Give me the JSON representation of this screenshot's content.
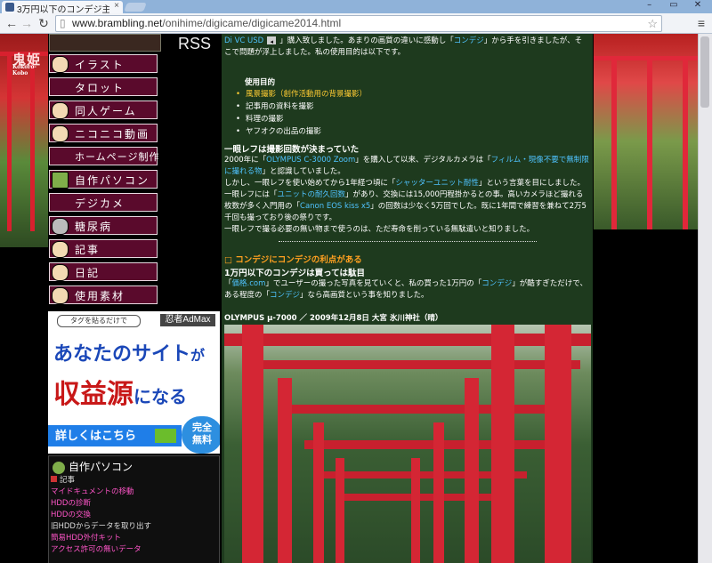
{
  "browser": {
    "tab_title": "3万円以下のコンデジ主…",
    "tab_close": "×",
    "url_host": "www.brambling.net",
    "url_path": "/onihime/digicame/digicame2014.html",
    "win_controls": [
      "–",
      "▭",
      "✕"
    ]
  },
  "site": {
    "logo_text": "鬼姫",
    "logo_small": "Kokoro-Kobo",
    "rss_label": "RSS"
  },
  "menu": {
    "items": [
      {
        "label": "イラスト",
        "name": "illust"
      },
      {
        "label": "タロット",
        "name": "tarot"
      },
      {
        "label": "同人ゲーム",
        "name": "doujin-game"
      },
      {
        "label": "ニコニコ動画",
        "name": "niconico"
      },
      {
        "label": "ホームページ制作",
        "name": "homepage"
      },
      {
        "label": "自作パソコン",
        "name": "jisaku-pc"
      },
      {
        "label": "デジカメ",
        "name": "digicame"
      },
      {
        "label": "糖尿病",
        "name": "diabetes"
      },
      {
        "label": "記事",
        "name": "articles"
      },
      {
        "label": "日記",
        "name": "diary"
      },
      {
        "label": "使用素材",
        "name": "materials"
      }
    ]
  },
  "ad": {
    "pill": "タグを貼るだけで",
    "brand": "忍者AdMax",
    "line1": "あなたのサイト",
    "line1_suffix": "が",
    "line2": "収益源",
    "line2_suffix": "になる",
    "cta": "詳しくはこちら",
    "free": "完全\n無料"
  },
  "side_section": {
    "title": "自作パソコン",
    "items": [
      {
        "text": "記事",
        "type": "plain-icon"
      },
      {
        "text": "マイドキュメントの移動",
        "type": "link"
      },
      {
        "text": "HDDの診断",
        "type": "link"
      },
      {
        "text": "HDDの交換",
        "type": "link"
      },
      {
        "text": "旧HDDからデータを取り出す",
        "type": "plain"
      },
      {
        "text": "簡易HDD外付キット",
        "type": "link"
      },
      {
        "text": "アクセス許可の無いデータ",
        "type": "link"
      }
    ]
  },
  "article": {
    "intro": {
      "link1": "Di VC USD",
      "text": "」購入致しました。あまりの画質の違いに感動し「",
      "link2": "コンデジ",
      "text2": "」から手を引きましたが、そこで問題が浮上しました。私の使用目的は以下です。"
    },
    "purpose_title": "使用目的",
    "purpose": [
      {
        "text": "風景撮影（創作活動用の背景撮影）",
        "hl": true
      },
      {
        "text": "記事用の資料を撮影",
        "hl": false
      },
      {
        "text": "料理の撮影",
        "hl": false
      },
      {
        "text": "ヤフオクの出品の撮影",
        "hl": false
      }
    ],
    "h1": "一眼レフは撮影回数が決まっていた",
    "p1": {
      "a": "2000年に「",
      "l1": "OLYMPUS C-3000 Zoom",
      "b": "」を購入して以来、デジタルカメラは「",
      "l2": "フィルム・現像不要で無制限に撮れる物",
      "c": "」と認識していました。",
      "d": "しかし、一眼レフを使い始めてから1年経つ頃に「",
      "l3": "シャッターユニット耐性",
      "e": "」という言葉を目にしました。一眼レフには「",
      "l4": "ユニットの耐久回数",
      "f": "」があり、交換には15,000円程掛かるとの事。高いカメラほど撮れる枚数が多く入門用の「",
      "l5": "Canon EOS kiss x5",
      "g": "」の回数は少なく5万回でした。既に1年間で練習を兼ねて2万5千回も撮っており後の祭りです。",
      "h": "一眼レフで撮る必要の無い物まで使うのは、ただ寿命を削っている無駄遣いと知りました。"
    },
    "h2": "□ コンデジにコンデジの利点がある",
    "h3": "1万円以下のコンデジは買っては駄目",
    "p2": {
      "a": "「",
      "l1": "価格.com",
      "b": "」でユーザーの撮った写真を見ていくと、私の買った1万円の「",
      "l2": "コンデジ",
      "c": "」が酷すぎただけで、ある程度の「",
      "l3": "コンデジ",
      "d": "」なら高画質という事を知りました。"
    },
    "photo_caption": "OLYMPUS μ-7000 ／ 2009年12月8日 大宮 氷川神社（晴）"
  }
}
